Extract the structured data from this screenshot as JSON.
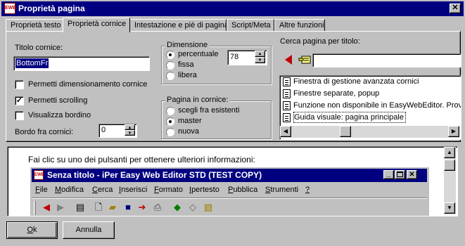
{
  "window": {
    "title": "Proprietà pagina",
    "close_glyph": "✕"
  },
  "tabs": [
    {
      "label": "Proprietà testo"
    },
    {
      "label": "Proprietà cornice"
    },
    {
      "label": "Intestazione e piè di pagina"
    },
    {
      "label": "Script/Meta"
    },
    {
      "label": "Altre funzioni"
    }
  ],
  "frame": {
    "title_label": "Titolo cornice:",
    "title_value": "BottomFr",
    "resize_label": "Permetti dimensionamento cornice",
    "resize_checked": false,
    "scroll_label": "Permetti scrolling",
    "scroll_checked": true,
    "border_label": "Visualizza bordino",
    "border_checked": false,
    "spacing_label": "Bordo fra cornici:",
    "spacing_value": "0"
  },
  "dimension": {
    "label": "Dimensione",
    "options": [
      "percentuale",
      "fissa",
      "libera"
    ],
    "selected": "percentuale",
    "value": "78"
  },
  "page_in_frame": {
    "label": "Pagina in cornice:",
    "options": [
      "scegli fra esistenti",
      "master",
      "nuova"
    ],
    "selected": "master"
  },
  "search": {
    "label": "Cerca pagina per titolo:",
    "value": "",
    "results": [
      "Finestra di gestione avanzata cornici",
      "Finestre separate, popup",
      "Funzione non disponibile in EasyWebEditor. Prov",
      "Guida visuale: pagina principale"
    ],
    "selected_index": 3
  },
  "help": {
    "text": "Fai clic su uno dei pulsanti per ottenere ulteriori informazioni:",
    "preview_title": "Senza titolo - iPer Easy Web Editor STD (TEST COPY)",
    "app_icon_text": "EWE",
    "menu": [
      {
        "key": "F",
        "rest": "ile"
      },
      {
        "key": "M",
        "rest": "odifica"
      },
      {
        "key": "C",
        "rest": "erca"
      },
      {
        "key": "I",
        "rest": "nserisci"
      },
      {
        "key": "F",
        "rest": "ormato"
      },
      {
        "key": "I",
        "rest": "pertesto"
      },
      {
        "key": "P",
        "rest": "ubblica"
      },
      {
        "key": "S",
        "rest": "trumenti"
      },
      {
        "key": "?",
        "rest": ""
      }
    ]
  },
  "buttons": {
    "ok_key": "O",
    "ok_rest": "k",
    "cancel": "Annulla"
  },
  "colors": {
    "titlebar": "#000080",
    "selection": "#000080",
    "face": "#c0c0c0",
    "arrow_red": "#c00000"
  }
}
